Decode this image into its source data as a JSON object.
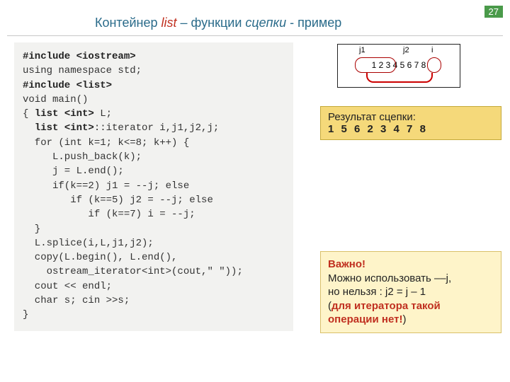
{
  "page_number": "27",
  "title": {
    "t1": "Контейнер ",
    "red": "list",
    "t2": "  – функции ",
    "it": "сцепки",
    "t3": " - пример"
  },
  "code": {
    "l01a": "#include ",
    "l01b": "<iostream>",
    "l02": "using namespace std;",
    "l03a": "#include ",
    "l03b": "<list>",
    "l04": "void main()",
    "l05a": "{ ",
    "l05b": "list <int>",
    "l05c": " L;",
    "l06a": "  ",
    "l06b": "list <int>",
    "l06c": "::iterator i,j1,j2,j;",
    "l07": "  for (int k=1; k<=8; k++) {",
    "l08": "     L.push_back(k);",
    "l09": "     j = L.end();",
    "l10": "     if(k==2) j1 = --j; else",
    "l11": "        if (k==5) j2 = --j; else",
    "l12": "           if (k==7) i = --j;",
    "l13": "  }",
    "l14": "  L.splice(i,L,j1,j2);",
    "l15": "  copy(L.begin(), L.end(),",
    "l16": "    ostream_iterator<int>(cout,\" \"));",
    "l17": "  cout << endl;",
    "l18": "  char s; cin >>s;",
    "l19": "}"
  },
  "diagram": {
    "j1": "j1",
    "j2": "j2",
    "i": "i",
    "nums": "1   2   3   4   5   6   7   8"
  },
  "result": {
    "label": "Результат сцепки:",
    "seq": "1 5 6 2 3 4 7 8"
  },
  "note": {
    "strong": "Важно!",
    "l1": "Можно использовать ––j,",
    "l2": "но нельзя :  j2 = j – 1",
    "l3a": "(",
    "redb": "для итератора такой операции нет!",
    "l3c": ")"
  }
}
